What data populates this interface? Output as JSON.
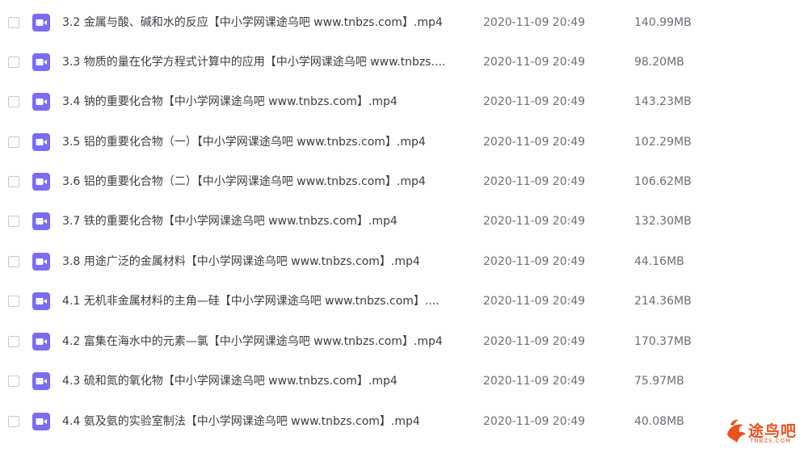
{
  "files": [
    {
      "name": "3.2 金属与酸、碱和水的反应【中小学网课途乌吧 www.tnbzs.com】.mp4",
      "date": "2020-11-09 20:49",
      "size": "140.99MB"
    },
    {
      "name": "3.3 物质的量在化学方程式计算中的应用【中小学网课途乌吧 www.tnbzs....",
      "date": "2020-11-09 20:49",
      "size": "98.20MB"
    },
    {
      "name": "3.4 钠的重要化合物【中小学网课途乌吧 www.tnbzs.com】.mp4",
      "date": "2020-11-09 20:49",
      "size": "143.23MB"
    },
    {
      "name": "3.5 铝的重要化合物（一）【中小学网课途乌吧 www.tnbzs.com】.mp4",
      "date": "2020-11-09 20:49",
      "size": "102.29MB"
    },
    {
      "name": "3.6 铝的重要化合物（二）【中小学网课途乌吧 www.tnbzs.com】.mp4",
      "date": "2020-11-09 20:49",
      "size": "106.62MB"
    },
    {
      "name": "3.7 铁的重要化合物【中小学网课途乌吧 www.tnbzs.com】.mp4",
      "date": "2020-11-09 20:49",
      "size": "132.30MB"
    },
    {
      "name": "3.8 用途广泛的金属材料【中小学网课途乌吧 www.tnbzs.com】.mp4",
      "date": "2020-11-09 20:49",
      "size": "44.16MB"
    },
    {
      "name": "4.1 无机非金属材料的主角—硅【中小学网课途乌吧 www.tnbzs.com】....",
      "date": "2020-11-09 20:49",
      "size": "214.36MB"
    },
    {
      "name": "4.2 富集在海水中的元素—氯【中小学网课途乌吧 www.tnbzs.com】.mp4",
      "date": "2020-11-09 20:49",
      "size": "170.37MB"
    },
    {
      "name": "4.3 硫和氮的氧化物【中小学网课途乌吧 www.tnbzs.com】.mp4",
      "date": "2020-11-09 20:49",
      "size": "75.97MB"
    },
    {
      "name": "4.4 氨及氨的实验室制法【中小学网课途乌吧 www.tnbzs.com】.mp4",
      "date": "2020-11-09 20:49",
      "size": "40.08MB"
    }
  ],
  "file_icon": "video-file-icon",
  "colors": {
    "icon": "#7b6cf2",
    "name_text": "#3a3d44",
    "meta_text": "#6b6f78",
    "watermark": "#e8531c"
  },
  "watermark": {
    "title": "途鸟吧",
    "subtitle": "TNBZS.COM"
  }
}
